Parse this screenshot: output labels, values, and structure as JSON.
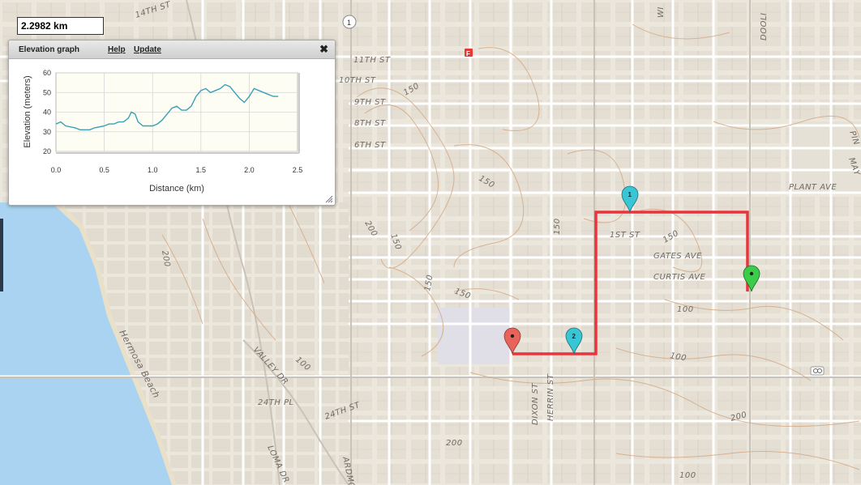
{
  "distance_readout": "2.2982 km",
  "elevation_panel": {
    "title": "Elevation graph",
    "help_label": "Help",
    "update_label": "Update",
    "close_glyph": "✖",
    "x_axis_label": "Distance (km)",
    "y_axis_label": "Elevation (meters)",
    "x_ticks": [
      "0.0",
      "0.5",
      "1.0",
      "1.5",
      "2.0",
      "2.5"
    ],
    "y_ticks": [
      "20",
      "30",
      "40",
      "50",
      "60"
    ]
  },
  "chart_data": {
    "type": "line",
    "title": "",
    "xlabel": "Distance (km)",
    "ylabel": "Elevation (meters)",
    "xlim": [
      0,
      2.5
    ],
    "ylim": [
      20,
      60
    ],
    "grid": true,
    "line_color": "#3aa0b8",
    "series": [
      {
        "x": [
          0.0,
          0.05,
          0.1,
          0.2,
          0.25,
          0.3,
          0.35,
          0.4,
          0.5,
          0.55,
          0.6,
          0.65,
          0.7,
          0.75,
          0.78,
          0.82,
          0.85,
          0.9,
          0.95,
          1.0,
          1.05,
          1.1,
          1.15,
          1.2,
          1.25,
          1.3,
          1.35,
          1.4,
          1.45,
          1.5,
          1.55,
          1.6,
          1.65,
          1.7,
          1.75,
          1.8,
          1.85,
          1.9,
          1.95,
          2.0,
          2.05,
          2.1,
          2.15,
          2.2,
          2.25,
          2.3
        ],
        "y": [
          34,
          35,
          33,
          32,
          31,
          31,
          31,
          32,
          33,
          34,
          34,
          35,
          35,
          37,
          40,
          39,
          35,
          33,
          33,
          33,
          34,
          36,
          39,
          42,
          43,
          41,
          41,
          43,
          48,
          51,
          52,
          50,
          51,
          52,
          54,
          53,
          50,
          47,
          45,
          48,
          52,
          51,
          50,
          49,
          48,
          48
        ]
      }
    ]
  },
  "map": {
    "route_color": "#e8343c",
    "street_labels": [
      "14TH ST",
      "11TH ST",
      "10TH ST",
      "9TH ST",
      "8TH ST",
      "6TH ST",
      "1ST ST",
      "GATES AVE",
      "CURTIS AVE",
      "PLANT AVE",
      "VALLEY DR",
      "24TH PL",
      "24TH ST",
      "DIXON ST",
      "HERRIN ST",
      "LOMA DR",
      "ARDMO",
      "Hermosa Beach",
      "DOOLI",
      "WI",
      "PIN",
      "MAY"
    ],
    "contour_labels": [
      "150",
      "100",
      "200",
      "150",
      "150",
      "150",
      "150",
      "100",
      "100",
      "200",
      "100",
      "150",
      "200",
      "200",
      "150"
    ],
    "route_shield": "1",
    "poi_badge": "F",
    "markers": [
      {
        "name": "start",
        "color": "#e8635a"
      },
      {
        "name": "waypoint-2",
        "color": "#38c6d4",
        "label": "2"
      },
      {
        "name": "waypoint-1",
        "color": "#38c6d4",
        "label": "1"
      },
      {
        "name": "end",
        "color": "#3bcc4a"
      }
    ]
  }
}
